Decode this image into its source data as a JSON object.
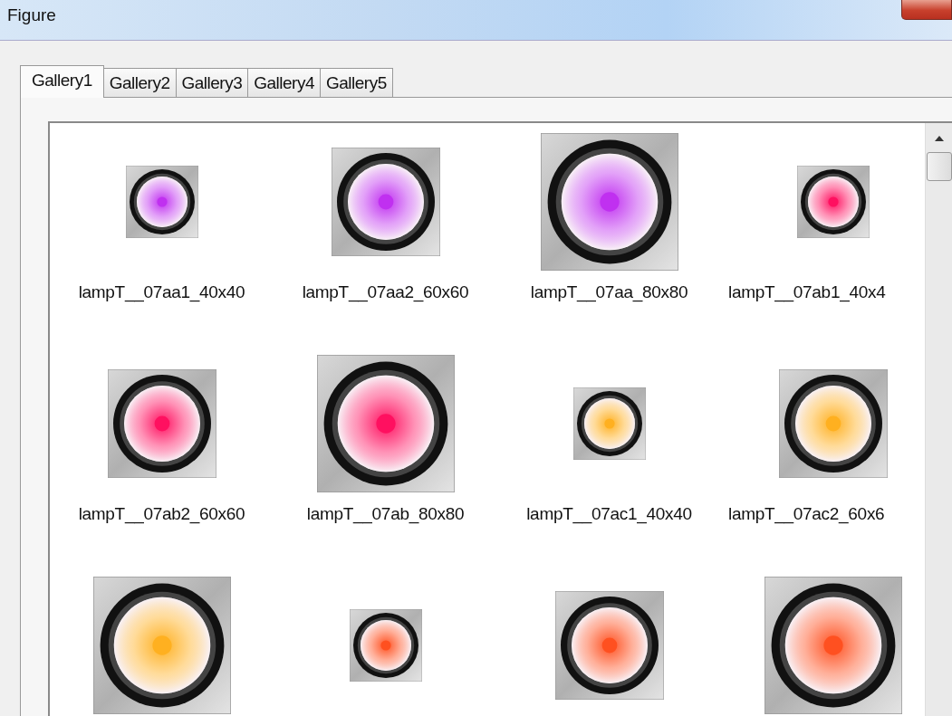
{
  "window": {
    "title": "Figure"
  },
  "tabs": [
    {
      "label": "Gallery1",
      "selected": true
    },
    {
      "label": "Gallery2",
      "selected": false
    },
    {
      "label": "Gallery3",
      "selected": false
    },
    {
      "label": "Gallery4",
      "selected": false
    },
    {
      "label": "Gallery5",
      "selected": false
    }
  ],
  "gallery": {
    "items": [
      {
        "label": "lampT__07aa1_40x40",
        "kind": "small",
        "color": "#c030f0"
      },
      {
        "label": "lampT__07aa2_60x60",
        "kind": "medium",
        "color": "#c030f0"
      },
      {
        "label": "lampT__07aa_80x80",
        "kind": "large",
        "color": "#c030f0"
      },
      {
        "label": "lampT__07ab1_40x4",
        "kind": "small",
        "color": "#ff1060"
      },
      {
        "label": "lampT__07ab2_60x60",
        "kind": "medium",
        "color": "#ff1060"
      },
      {
        "label": "lampT__07ab_80x80",
        "kind": "large",
        "color": "#ff1060"
      },
      {
        "label": "lampT__07ac1_40x40",
        "kind": "small",
        "color": "#ffb020"
      },
      {
        "label": "lampT__07ac2_60x6",
        "kind": "medium",
        "color": "#ffb020"
      },
      {
        "kind": "large",
        "color": "#ffb020"
      },
      {
        "kind": "small",
        "color": "#ff5020"
      },
      {
        "kind": "medium",
        "color": "#ff5020"
      },
      {
        "kind": "large",
        "color": "#ff5020"
      }
    ]
  }
}
